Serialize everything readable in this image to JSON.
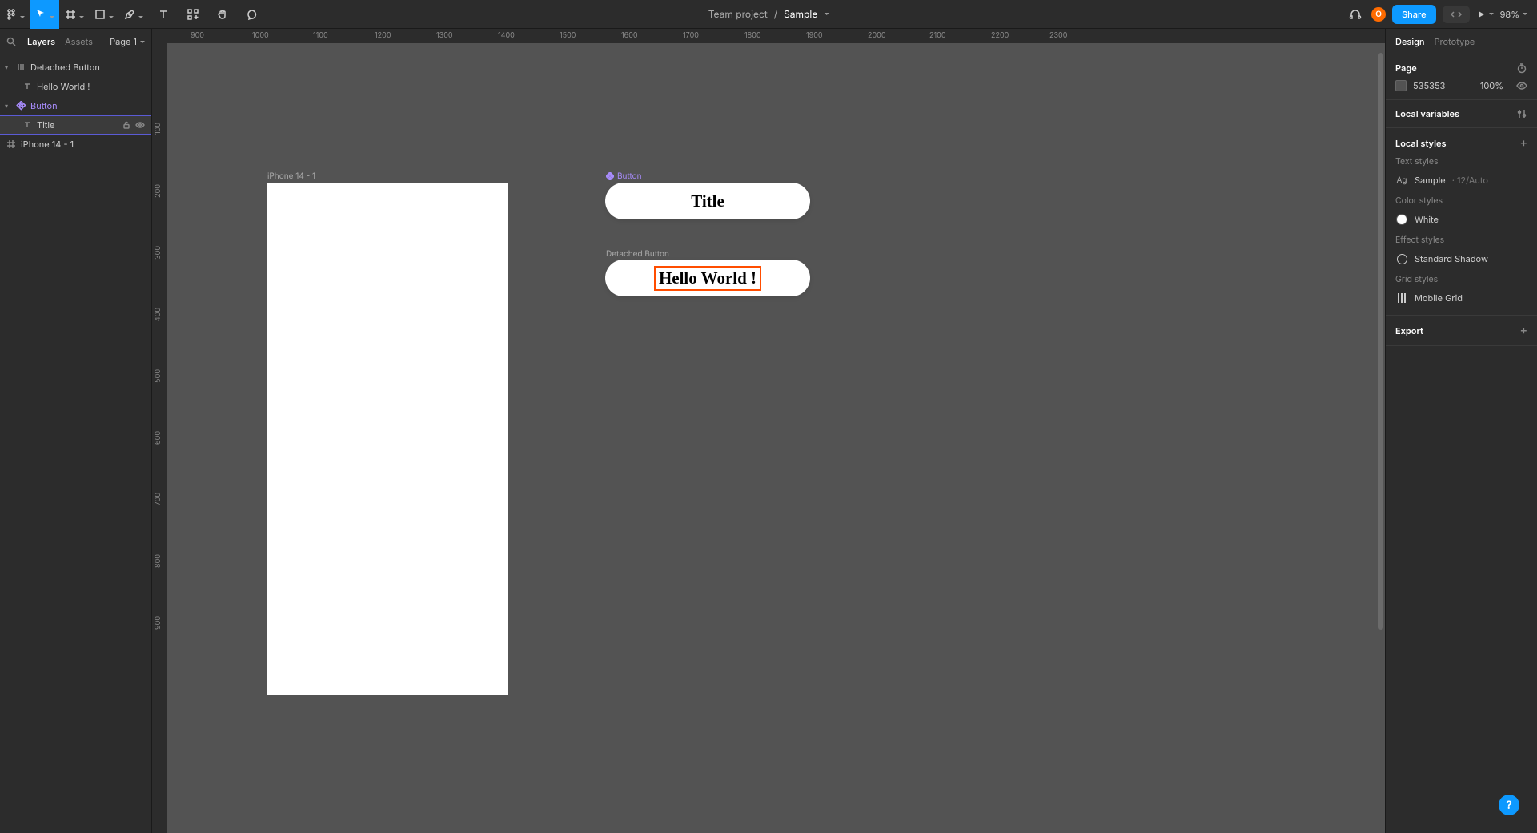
{
  "breadcrumb": {
    "project": "Team project",
    "file": "Sample"
  },
  "toolbar": {
    "share": "Share",
    "zoom": "98%",
    "avatar_initial": "O"
  },
  "left": {
    "tabs": {
      "layers": "Layers",
      "assets": "Assets"
    },
    "page": "Page 1",
    "layers": {
      "detached_button": "Detached Button",
      "hello_world": "Hello World !",
      "button": "Button",
      "title": "Title",
      "iphone": "iPhone 14 - 1"
    }
  },
  "canvas": {
    "ruler_h": [
      "900",
      "1000",
      "1100",
      "1200",
      "1300",
      "1400",
      "1500",
      "1600",
      "1700",
      "1800",
      "1900",
      "2000",
      "2100",
      "2200",
      "2300"
    ],
    "ruler_v": [
      "100",
      "200",
      "300",
      "400",
      "500",
      "600",
      "700",
      "800",
      "900"
    ],
    "frame_label": "iPhone 14 - 1",
    "button_label": "Button",
    "button_text": "Title",
    "detached_label": "Detached Button",
    "detached_text": "Hello World !"
  },
  "right": {
    "tabs": {
      "design": "Design",
      "prototype": "Prototype"
    },
    "page_section": "Page",
    "page_color": "535353",
    "page_opacity": "100%",
    "local_variables": "Local variables",
    "local_styles": "Local styles",
    "text_styles": "Text styles",
    "text_style_item": {
      "name": "Sample",
      "meta": "12/Auto",
      "prefix": "Ag"
    },
    "color_styles": "Color styles",
    "color_item": "White",
    "effect_styles": "Effect styles",
    "effect_item": "Standard Shadow",
    "grid_styles": "Grid styles",
    "grid_item": "Mobile Grid",
    "export": "Export"
  },
  "help": "?"
}
